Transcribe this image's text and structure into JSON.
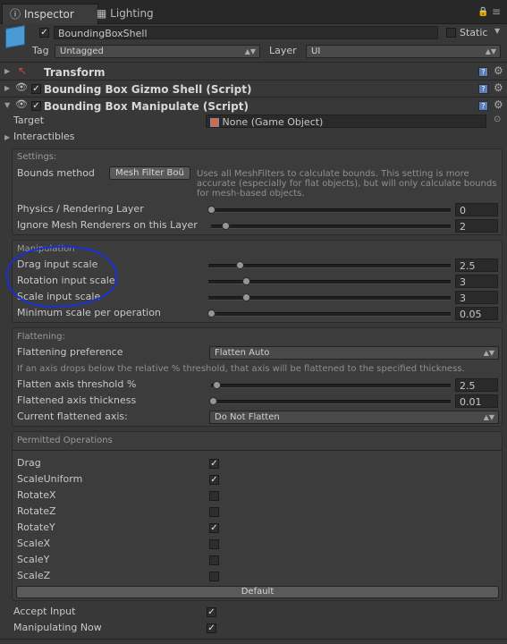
{
  "tabs": [
    {
      "label": "Inspector",
      "icon": "info-icon"
    },
    {
      "label": "Lighting",
      "icon": "lighting-grid-icon"
    }
  ],
  "gameobject": {
    "name": "BoundingBoxShell",
    "static_label": "Static",
    "tag_label": "Tag",
    "tag_value": "Untagged",
    "layer_label": "Layer",
    "layer_value": "UI"
  },
  "components": [
    {
      "name": "Transform"
    },
    {
      "name": "Bounding Box Gizmo Shell (Script)"
    },
    {
      "name": "Bounding Box Manipulate (Script)"
    }
  ],
  "manipulate": {
    "target_label": "Target",
    "target_value": "None (Game Object)",
    "interactibles_label": "Interactibles",
    "settings": {
      "title": "Settings:",
      "bounds_method_label": "Bounds method",
      "bounds_method_value": "Mesh Filter Boü",
      "bounds_help": [
        "Uses all MeshFilters to calculate bounds. This setting is more",
        "accurate (especially for flat objects), but will only calculate bounds",
        "for mesh-based objects."
      ],
      "physics_layer_label": "Physics / Rendering Layer",
      "physics_layer_value": "0",
      "ignore_layer_label": "Ignore Mesh Renderers on this Layer",
      "ignore_layer_value": "2"
    },
    "manipulation": {
      "title": "Manipulation",
      "drag_label": "Drag input scale",
      "drag_value": "2.5",
      "rotation_label": "Rotation input scale",
      "rotation_value": "3",
      "scale_label": "Scale input scale",
      "scale_value": "3",
      "min_scale_label": "Minimum scale per operation",
      "min_scale_value": "0.05"
    },
    "flattening": {
      "title": "Flattening:",
      "preference_label": "Flattening preference",
      "preference_value": "Flatten Auto",
      "help": "If an axis drops below the relative % threshold, that axis will be flattened to the specified thickness.",
      "threshold_label": "Flatten axis threshold %",
      "threshold_value": "2.5",
      "thickness_label": "Flattened axis thickness",
      "thickness_value": "0.01",
      "current_axis_label": "Current flattened axis:",
      "current_axis_value": "Do Not Flatten"
    },
    "permitted": {
      "title": "Permitted Operations",
      "ops": [
        {
          "label": "Drag",
          "checked": true
        },
        {
          "label": "ScaleUniform",
          "checked": true
        },
        {
          "label": "RotateX",
          "checked": false
        },
        {
          "label": "RotateZ",
          "checked": false
        },
        {
          "label": "RotateY",
          "checked": true
        },
        {
          "label": "ScaleX",
          "checked": false
        },
        {
          "label": "ScaleY",
          "checked": false
        },
        {
          "label": "ScaleZ",
          "checked": false
        }
      ],
      "default_button": "Default"
    },
    "accept_input_label": "Accept Input",
    "accept_input_checked": true,
    "manipulating_now_label": "Manipulating Now",
    "manipulating_now_checked": true
  },
  "colors": {
    "background": "#383838",
    "annotation_circle": "#1a2fd6"
  }
}
